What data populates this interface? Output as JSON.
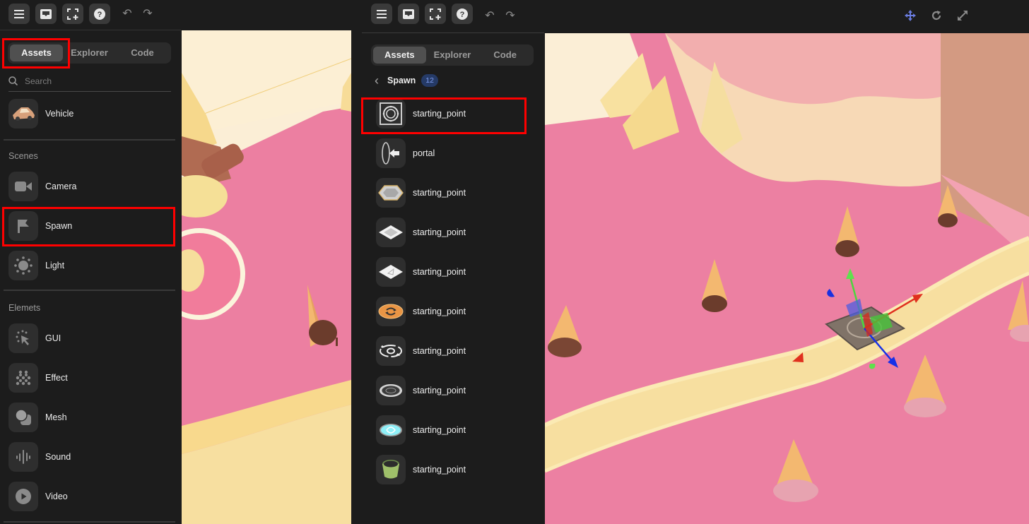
{
  "colors": {
    "panel_bg": "#1c1c1c",
    "button_bg": "#3a3a3a",
    "highlight": "#ff0000",
    "badge_bg": "#253a66",
    "badge_text": "#7f9df0",
    "move_tool_active": "#6a7ce0",
    "scene_pink": "#ec7fa0",
    "scene_cream": "#fbeccd",
    "scene_path": "#f7df9e"
  },
  "toolbar": {
    "buttons": [
      {
        "name": "menu",
        "icon": "hamburger-menu-icon"
      },
      {
        "name": "inbox",
        "icon": "inbox-tray-icon"
      },
      {
        "name": "add-frame",
        "icon": "frame-add-icon"
      },
      {
        "name": "help",
        "icon": "question-circle-icon"
      }
    ],
    "undo_icon": "undo-icon",
    "redo_icon": "redo-icon",
    "undo_glyph": "↶",
    "redo_glyph": "↷"
  },
  "viewport_tools": [
    {
      "name": "move",
      "icon": "move-arrows-icon",
      "active": true
    },
    {
      "name": "rotate",
      "icon": "rotate-icon",
      "active": false
    },
    {
      "name": "scale",
      "icon": "scale-diagonal-icon",
      "active": false
    }
  ],
  "tabs": [
    {
      "label": "Assets",
      "active": true
    },
    {
      "label": "Explorer",
      "active": false
    },
    {
      "label": "Code",
      "active": false
    }
  ],
  "left_panel": {
    "search_placeholder": "Search",
    "top_item": {
      "label": "Vehicle",
      "icon": "car-icon"
    },
    "sections": [
      {
        "title": "Scenes",
        "items": [
          {
            "label": "Camera",
            "icon": "video-camera-icon"
          },
          {
            "label": "Spawn",
            "icon": "flag-icon",
            "highlighted": true
          },
          {
            "label": "Light",
            "icon": "sun-icon"
          }
        ]
      },
      {
        "title": "Elemets",
        "items": [
          {
            "label": "GUI",
            "icon": "cursor-click-icon"
          },
          {
            "label": "Effect",
            "icon": "particles-icon"
          },
          {
            "label": "Mesh",
            "icon": "shapes-icon"
          },
          {
            "label": "Sound",
            "icon": "sound-wave-icon"
          },
          {
            "label": "Video",
            "icon": "play-circle-icon"
          }
        ]
      }
    ]
  },
  "right_panel": {
    "breadcrumb": {
      "back_icon": "chevron-left-icon",
      "back_glyph": "‹",
      "title": "Spawn",
      "count": "12"
    },
    "items": [
      {
        "label": "starting_point",
        "thumb": "target-square",
        "highlighted": true
      },
      {
        "label": "portal",
        "thumb": "portal-ring"
      },
      {
        "label": "starting_point",
        "thumb": "hexagon-pad"
      },
      {
        "label": "starting_point",
        "thumb": "diamond-pad"
      },
      {
        "label": "starting_point",
        "thumb": "diamond-arrow-pad"
      },
      {
        "label": "starting_point",
        "thumb": "orange-ring-pad"
      },
      {
        "label": "starting_point",
        "thumb": "orbit-ring"
      },
      {
        "label": "starting_point",
        "thumb": "ornate-disc"
      },
      {
        "label": "starting_point",
        "thumb": "cyan-swirl-disc"
      },
      {
        "label": "starting_point",
        "thumb": "green-pot"
      }
    ]
  }
}
